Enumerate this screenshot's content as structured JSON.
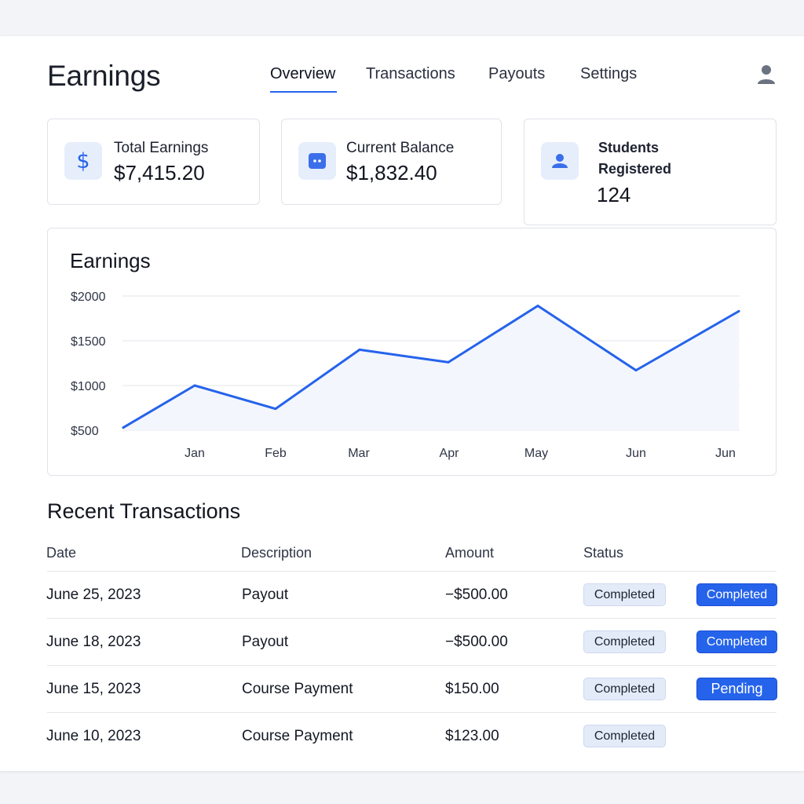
{
  "header": {
    "title": "Earnings",
    "tabs": [
      {
        "label": "Overview",
        "active": true
      },
      {
        "label": "Transactions",
        "active": false
      },
      {
        "label": "Payouts",
        "active": false
      },
      {
        "label": "Settings",
        "active": false
      }
    ],
    "avatar_icon": "user-icon"
  },
  "stats": [
    {
      "label": "Total Earnings",
      "value": "$7,415.20",
      "icon": "dollar-icon"
    },
    {
      "label": "Current Balance",
      "value": "$1,832.40",
      "icon": "wallet-icon"
    },
    {
      "label_line1": "Students",
      "label_line2": "Registered",
      "value": "124",
      "icon": "user-icon"
    }
  ],
  "chart": {
    "title": "Earnings"
  },
  "chart_data": {
    "type": "area",
    "title": "Earnings",
    "xlabel": "",
    "ylabel": "",
    "categories": [
      "",
      "Jan",
      "Feb",
      "Mar",
      "Apr",
      "May",
      "Jun",
      "Jun"
    ],
    "values": [
      530,
      1000,
      740,
      1400,
      1260,
      1890,
      1170,
      1830
    ],
    "yticks": [
      "$2000",
      "$1500",
      "$1000",
      "$500"
    ],
    "ytick_values": [
      2000,
      1500,
      1000,
      500
    ],
    "ylim": [
      500,
      2000
    ],
    "grid": true,
    "legend": "none",
    "colors": {
      "line": "#2563eb",
      "fill": "#f3f6fd",
      "grid": "#e3e6eb"
    }
  },
  "transactions": {
    "title": "Recent Transactions",
    "columns": [
      "Date",
      "Description",
      "Amount",
      "Status"
    ],
    "rows": [
      {
        "date": "June 25, 2023",
        "description": "Payout",
        "amount": "−$500.00",
        "status": "Completed",
        "extra_status": "Completed"
      },
      {
        "date": "June 18, 2023",
        "description": "Payout",
        "amount": "−$500.00",
        "status": "Completed",
        "extra_status": "Completed"
      },
      {
        "date": "June 15, 2023",
        "description": "Course Payment",
        "amount": "$150.00",
        "status": "Completed",
        "extra_status": "Pending"
      },
      {
        "date": "June 10, 2023",
        "description": "Course Payment",
        "amount": "$123.00",
        "status": "Completed",
        "extra_status": ""
      }
    ]
  },
  "colors": {
    "accent": "#2563eb",
    "badge_light": "#e3ebf9",
    "background": "#f3f4f7"
  }
}
